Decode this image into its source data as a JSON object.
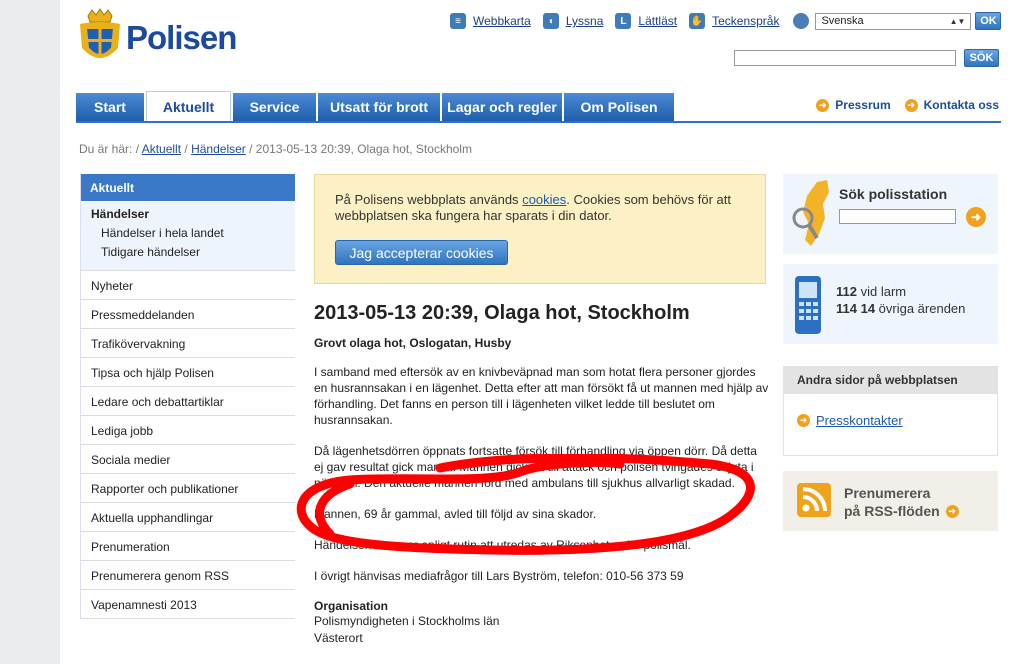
{
  "header": {
    "logo_text": "Polisen",
    "toplinks": [
      {
        "label": "Webbkarta",
        "icon": "sitemap-icon"
      },
      {
        "label": "Lyssna",
        "icon": "listen-icon"
      },
      {
        "label": "Lättläst",
        "icon": "easy-read-icon"
      },
      {
        "label": "Teckenspråk",
        "icon": "sign-language-icon"
      }
    ],
    "language": "Svenska",
    "ok_label": "OK",
    "search_label": "SÖK"
  },
  "nav": {
    "tabs": [
      "Start",
      "Aktuellt",
      "Service",
      "Utsatt för brott",
      "Lagar och regler",
      "Om Polisen"
    ],
    "active": "Aktuellt",
    "right_links": [
      "Pressrum",
      "Kontakta oss"
    ]
  },
  "breadcrumb": {
    "prefix": "Du är här: /",
    "crumb1": "Aktuellt",
    "sep": "/",
    "crumb2": "Händelser",
    "current": "/ 2013-05-13 20:39, Olaga hot, Stockholm"
  },
  "sidebar": {
    "heading": "Aktuellt",
    "sub_heading": "Händelser",
    "sub_items": [
      "Händelser i hela landet",
      "Tidigare händelser"
    ],
    "items": [
      "Nyheter",
      "Pressmeddelanden",
      "Trafikövervakning",
      "Tipsa och hjälp Polisen",
      "Ledare och debattartiklar",
      "Lediga jobb",
      "Sociala medier",
      "Rapporter och publikationer",
      "Aktuella upphandlingar",
      "Prenumeration",
      "Prenumerera genom RSS",
      "Vapenamnesti 2013"
    ]
  },
  "cookie": {
    "text_before": "På Polisens webbplats används ",
    "link": "cookies",
    "text_after": ". Cookies som behövs för att webbplatsen ska fungera har sparats i din dator.",
    "button": "Jag accepterar cookies"
  },
  "article": {
    "title": "2013-05-13 20:39, Olaga hot, Stockholm",
    "subtitle": "Grovt olaga hot, Oslogatan, Husby",
    "paragraphs": [
      "I samband med eftersök av en knivbeväpnad man som hotat flera personer gjordes en husrannsakan i en lägenhet. Detta efter att man försökt få ut mannen med hjälp av förhandling. Det fanns en person till i lägenheten vilket ledde till beslutet om husrannsakan.",
      "Då lägenhetsdörren öppnats fortsatte försök till förhandling via öppen dörr. Då detta ej gav resultat gick man in. Mannen gick då till attack och polisen tvingades skjuta i nödvärn. Den aktuelle mannen förd med ambulans till sjukhus allvarligt skadad.",
      "Mannen, 69 år gammal, avled till följd av sina skador.",
      "Händelsen kommer enligt rutin att utredas av Riksenheten för polismål.",
      "I övrigt hänvisas mediafrågor till Lars Byström, telefon: 010-56 373 59"
    ],
    "org_heading": "Organisation",
    "org_lines": [
      "Polismyndigheten i Stockholms län",
      "Västerort"
    ]
  },
  "right": {
    "station_search": "Sök polisstation",
    "phone_line1_num": "112",
    "phone_line1_txt": " vid larm",
    "phone_line2_num": "114 14",
    "phone_line2_txt": " övriga ärenden",
    "other_heading": "Andra sidor på webbplatsen",
    "other_link": "Presskontakter",
    "rss_line1": "Prenumerera",
    "rss_line2": "på RSS-flöden"
  },
  "colors": {
    "brand_blue": "#2f72c3",
    "accent_orange": "#f0a21c",
    "annotation_red": "#ff0000"
  }
}
